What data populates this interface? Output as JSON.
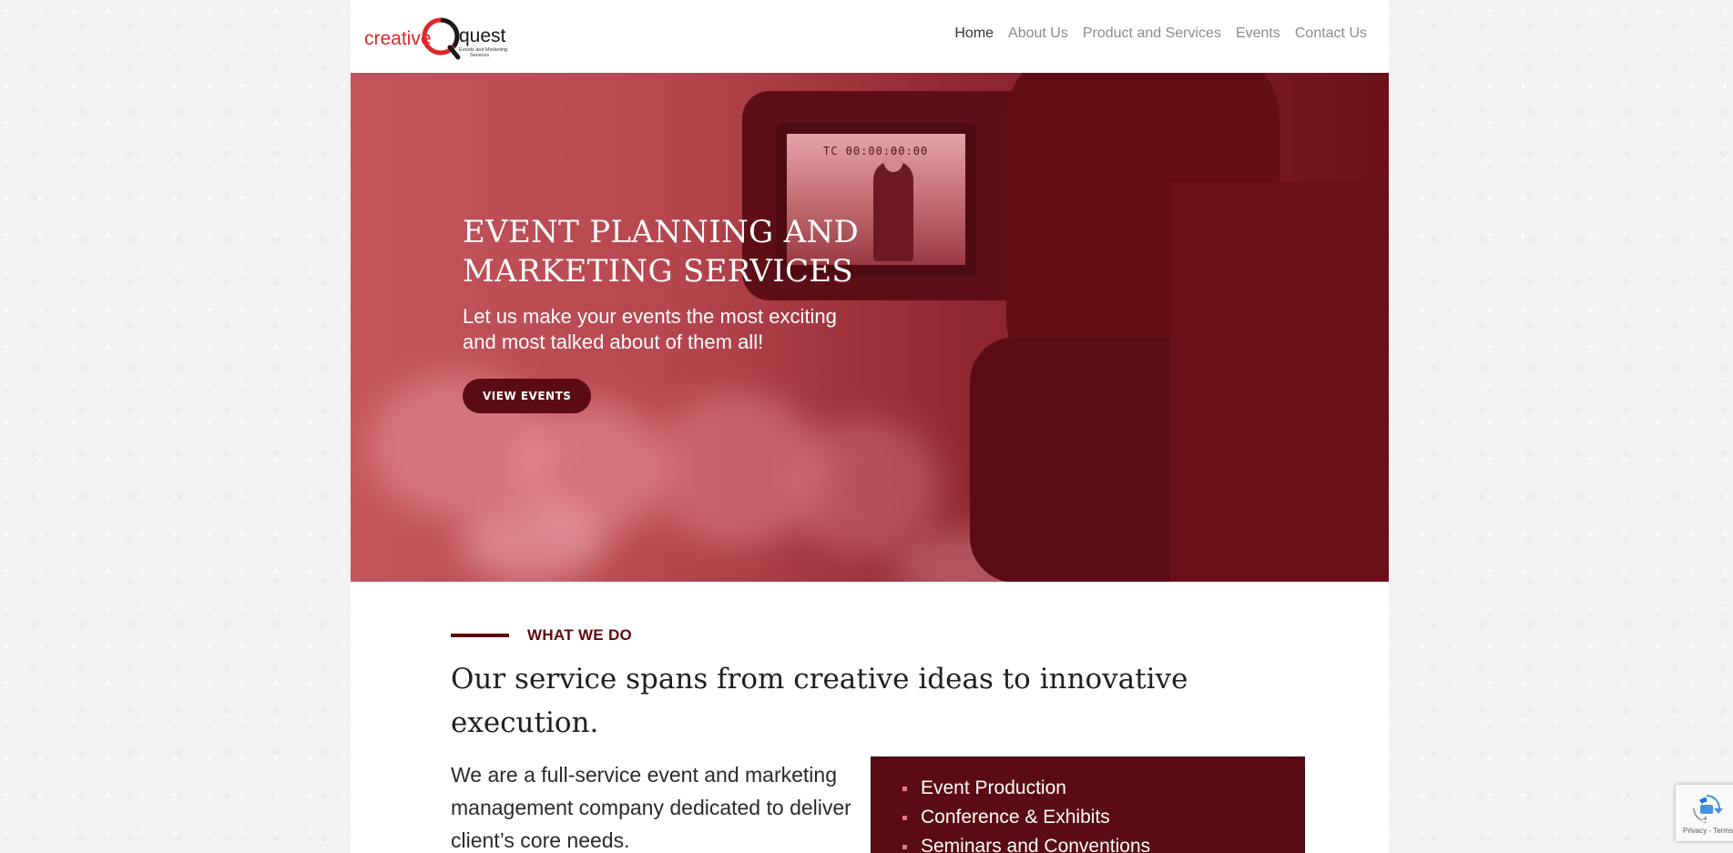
{
  "logo": {
    "word_left": "creative",
    "word_right": "quest",
    "tagline_1": "Events and Marketing",
    "tagline_2": "Services",
    "brand_color": "#e0252c"
  },
  "nav": {
    "items": [
      {
        "label": "Home",
        "active": true
      },
      {
        "label": "About Us",
        "active": false
      },
      {
        "label": "Product and Services",
        "active": false
      },
      {
        "label": "Events",
        "active": false
      },
      {
        "label": "Contact Us",
        "active": false
      }
    ]
  },
  "hero": {
    "title": "EVENT PLANNING AND MARKETING SERVICES",
    "subtitle": "Let us make your events the most exciting and most talked about of them all!",
    "button_label": "VIEW EVENTS",
    "screen_timecode": "TC 00:00:00:00",
    "overlay_color": "#6b1218"
  },
  "what_we_do": {
    "kicker": "WHAT WE DO",
    "headline": "Our service spans from creative ideas to innovative execution.",
    "body": "We are a full-service event and marketing management company dedicated to deliver client’s core needs.",
    "services": [
      "Event Production",
      "Conference & Exhibits",
      "Seminars and Conventions"
    ],
    "accent_color": "#5a0c12"
  },
  "recaptcha": {
    "terms": "Privacy - Terms"
  }
}
